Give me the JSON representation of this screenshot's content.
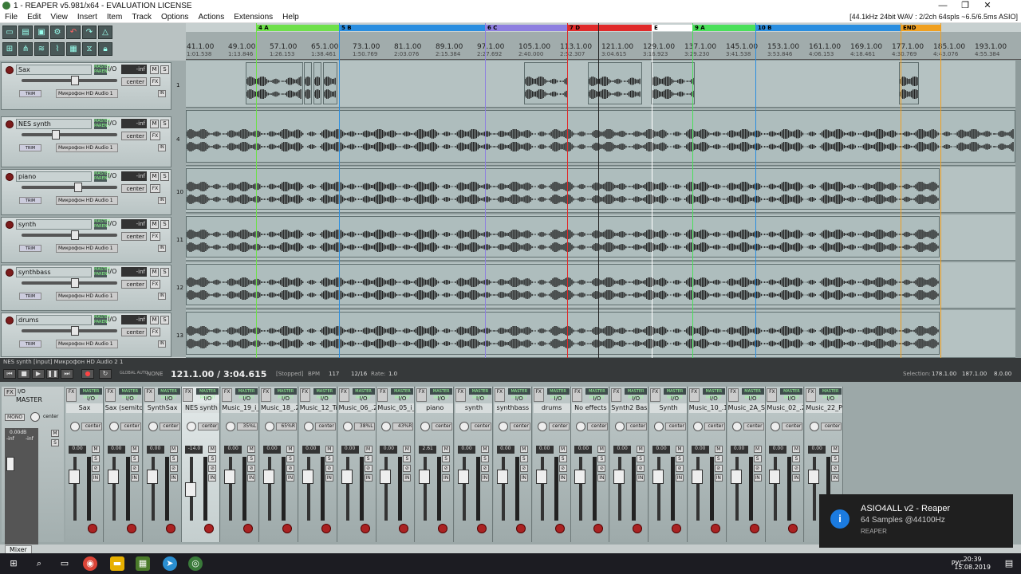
{
  "window": {
    "title": "1 - REAPER v5.981/x64 - EVALUATION LICENSE",
    "audio_info": "[44.1kHz 24bit WAV : 2/2ch 64spls ~6.5/6.5ms ASIO]"
  },
  "menu": [
    "File",
    "Edit",
    "View",
    "Insert",
    "Item",
    "Track",
    "Options",
    "Actions",
    "Extensions",
    "Help"
  ],
  "regions": [
    {
      "label": "4 A",
      "color": "#6ee04a"
    },
    {
      "label": "5 B",
      "color": "#2a8ee0"
    },
    {
      "label": "6 C",
      "color": "#8e7fe0"
    },
    {
      "label": "7 D",
      "color": "#e02a2a"
    },
    {
      "label": "E",
      "color": "#ffffff"
    },
    {
      "label": "9 A",
      "color": "#4ae05a"
    },
    {
      "label": "10 B",
      "color": "#2a8ee0"
    },
    {
      "label": "END",
      "color": "#f0a020"
    }
  ],
  "ruler": [
    {
      "bar": "41.1.00",
      "time": "1:01.538"
    },
    {
      "bar": "49.1.00",
      "time": "1:13.846"
    },
    {
      "bar": "57.1.00",
      "time": "1:26.153"
    },
    {
      "bar": "65.1.00",
      "time": "1:38.461"
    },
    {
      "bar": "73.1.00",
      "time": "1:50.769"
    },
    {
      "bar": "81.1.00",
      "time": "2:03.076"
    },
    {
      "bar": "89.1.00",
      "time": "2:15.384"
    },
    {
      "bar": "97.1.00",
      "time": "2:27.692"
    },
    {
      "bar": "105.1.00",
      "time": "2:40.000"
    },
    {
      "bar": "113.1.00",
      "time": "2:52.307"
    },
    {
      "bar": "121.1.00",
      "time": "3:04.615"
    },
    {
      "bar": "129.1.00",
      "time": "3:16.923"
    },
    {
      "bar": "137.1.00",
      "time": "3:29.230"
    },
    {
      "bar": "145.1.00",
      "time": "3:41.538"
    },
    {
      "bar": "153.1.00",
      "time": "3:53.846"
    },
    {
      "bar": "161.1.00",
      "time": "4:06.153"
    },
    {
      "bar": "169.1.00",
      "time": "4:18.461"
    },
    {
      "bar": "177.1.00",
      "time": "4:30.769"
    },
    {
      "bar": "185.1.00",
      "time": "4:43.076"
    },
    {
      "bar": "193.1.00",
      "time": "4:55.384"
    }
  ],
  "tracks": [
    {
      "name": "Sax",
      "vol": "-inf",
      "vol_val": "0.00",
      "pan": "center",
      "num": "1",
      "input": "Микрофон HD Audio 1"
    },
    {
      "name": "NES synth",
      "vol": "-inf",
      "vol_val": "-14.0",
      "pan": "center",
      "num": "4",
      "input": "Микрофон HD Audio 1"
    },
    {
      "name": "piano",
      "vol": "-inf",
      "vol_val": "2.61",
      "pan": "center",
      "num": "10",
      "input": "Микрофон HD Audio 1"
    },
    {
      "name": "synth",
      "vol": "-inf",
      "vol_val": "0.00",
      "pan": "center",
      "num": "11",
      "input": "Микрофон HD Audio 1"
    },
    {
      "name": "synthbass",
      "vol": "-inf",
      "vol_val": "0.00",
      "pan": "center",
      "num": "12",
      "input": "Микрофон HD Audio 1"
    },
    {
      "name": "drums",
      "vol": "-inf",
      "vol_val": "0.00",
      "pan": "center",
      "num": "13",
      "input": "Микрофон HD Audio 1"
    }
  ],
  "items": {
    "sax_rate": "[Rate: 0.171] Sax ...",
    "sax_a": "Sax A[2].wav",
    "sax_end": "Sax ...",
    "piano": "<< piano.wav",
    "synth": "<< synth.wav",
    "synthbass": "<< synthbass.wav",
    "drums": "<< drums.wav"
  },
  "labels": {
    "io": "I/O",
    "m": "M",
    "s": "S",
    "fx": "FX",
    "trim": "TRIM",
    "in": "IN",
    "route": "MASTER PARENT",
    "master": "MASTER",
    "mono": "MONO",
    "center": "center"
  },
  "transport": {
    "status": "NES synth [input] Микрофон HD Audio 2 1",
    "position": "121.1.00 / 3:04.615",
    "state": "[Stopped]",
    "bpm_label": "BPM",
    "bpm": "117",
    "sig": "12/16",
    "rate_label": "Rate:",
    "rate": "1.0",
    "global": "GLOBAL AUTO",
    "none": "NONE",
    "selection_label": "Selection:",
    "sel_start": "178.1.00",
    "sel_end": "187.1.00",
    "sel_len": "8.0.00"
  },
  "mixer": [
    {
      "name": "Sax",
      "pan": "center",
      "vol": "0.00",
      "num": "1"
    },
    {
      "name": "Sax (semitone",
      "pan": "center",
      "vol": "0.00",
      "num": "2"
    },
    {
      "name": "SynthSax",
      "pan": "center",
      "vol": "0.00",
      "num": "3"
    },
    {
      "name": "NES synth",
      "pan": "center",
      "vol": "-14.0",
      "num": "4"
    },
    {
      "name": "Music_19_i_5",
      "pan": "35%L",
      "vol": "0.00",
      "num": "5"
    },
    {
      "name": "Music_18_.25",
      "pan": "65%R",
      "vol": "0.00",
      "num": "6"
    },
    {
      "name": "Music_12_Tra",
      "pan": "center",
      "vol": "0.00",
      "num": "7"
    },
    {
      "name": "Music_06_.25",
      "pan": "38%L",
      "vol": "0.00",
      "num": "8"
    },
    {
      "name": "Music_05_i_5",
      "pan": "43%R",
      "vol": "0.00",
      "num": "9"
    },
    {
      "name": "piano",
      "pan": "center",
      "vol": "2.61",
      "num": "10"
    },
    {
      "name": "synth",
      "pan": "center",
      "vol": "0.00",
      "num": "11"
    },
    {
      "name": "synthbass",
      "pan": "center",
      "vol": "0.00",
      "num": "12"
    },
    {
      "name": "drums",
      "pan": "center",
      "vol": "0.00",
      "num": "13"
    },
    {
      "name": "No effects",
      "pan": "center",
      "vol": "0.00",
      "num": "14"
    },
    {
      "name": "Synth2 Bass",
      "pan": "center",
      "vol": "0.00",
      "num": "15"
    },
    {
      "name": "Synth",
      "pan": "center",
      "vol": "0.00",
      "num": "16"
    },
    {
      "name": "Music_10_.1",
      "pan": "center",
      "vol": "0.00",
      "num": "17"
    },
    {
      "name": "Music_2A_Sq",
      "pan": "center",
      "vol": "0.00",
      "num": "18"
    },
    {
      "name": "Music_02_.2",
      "pan": "center",
      "vol": "0.00",
      "num": "19"
    },
    {
      "name": "Music_22_Pia",
      "pan": "center",
      "vol": "0.00",
      "num": ""
    }
  ],
  "master": {
    "vol": "0.00dB",
    "l": "-inf",
    "r": "-inf"
  },
  "mixer_tab": "Mixer",
  "toast": {
    "title": "ASIO4ALL v2 - Reaper",
    "line": "64 Samples   @44100Hz",
    "app": "REAPER"
  },
  "taskbar": {
    "lang": "РУС",
    "time": "20:39",
    "date": "15.08.2019"
  }
}
